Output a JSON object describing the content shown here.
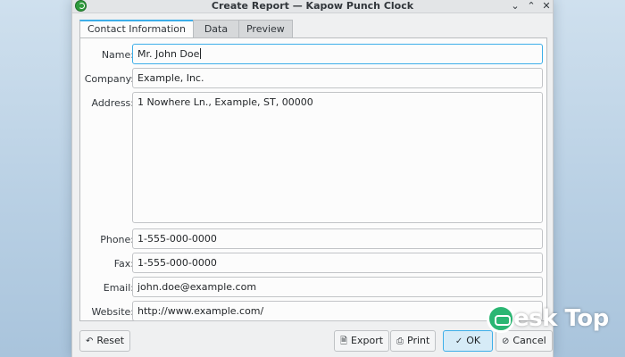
{
  "window": {
    "title": "Create Report — Kapow Punch Clock",
    "controls": [
      "chevron-down-icon",
      "restore-icon",
      "close-icon"
    ]
  },
  "tabs": [
    {
      "label": "Contact Information",
      "active": true
    },
    {
      "label": "Data",
      "active": false
    },
    {
      "label": "Preview",
      "active": false
    }
  ],
  "form": {
    "name": {
      "label": "Name:",
      "value": "Mr. John Doe"
    },
    "company": {
      "label": "Company:",
      "value": "Example, Inc."
    },
    "address": {
      "label": "Address:",
      "value": "1 Nowhere Ln., Example, ST, 00000"
    },
    "phone": {
      "label": "Phone:",
      "value": "1-555-000-0000"
    },
    "fax": {
      "label": "Fax:",
      "value": "1-555-000-0000"
    },
    "email": {
      "label": "Email:",
      "value": "john.doe@example.com"
    },
    "website": {
      "label": "Website:",
      "value": "http://www.example.com/"
    }
  },
  "buttons": {
    "reset": "Reset",
    "export": "Export",
    "print": "Print",
    "ok": "OK",
    "cancel": "Cancel"
  },
  "watermark": {
    "text": "esk Top",
    "logo": "watermark-logo"
  },
  "colors": {
    "accent": "#3daee9",
    "background": "#eff0f1",
    "field_bg": "#fcfcfc"
  }
}
